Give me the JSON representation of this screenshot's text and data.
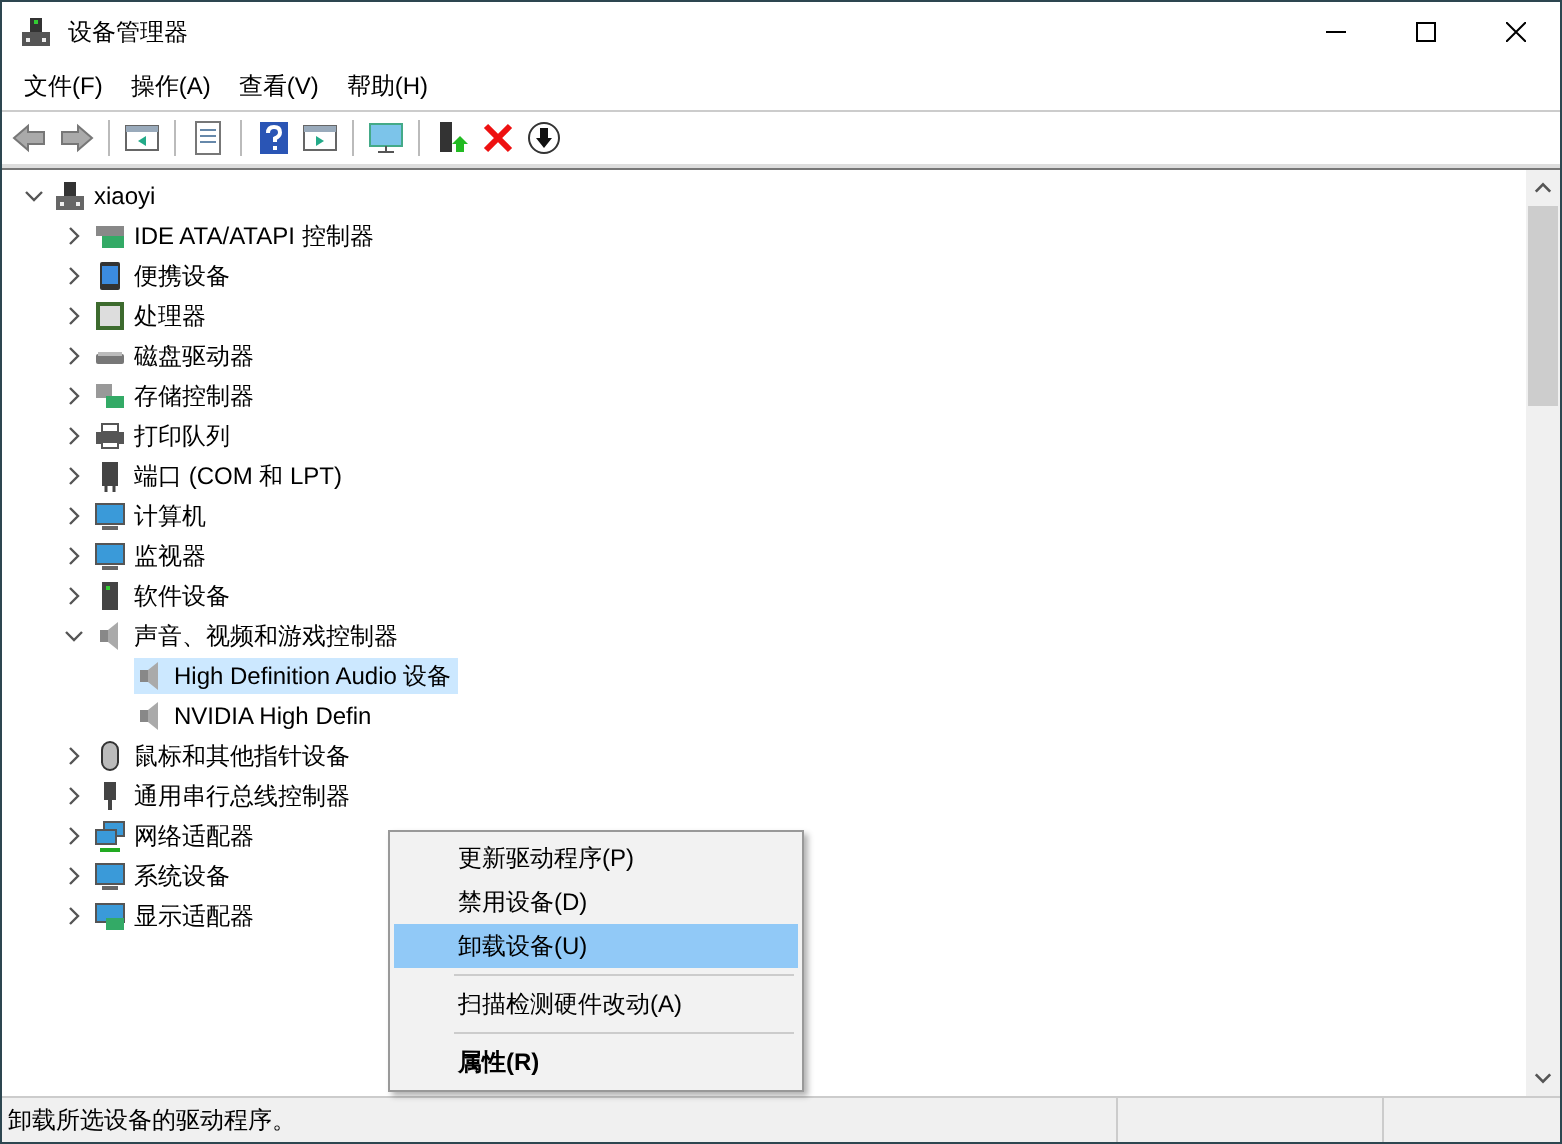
{
  "window": {
    "title": "设备管理器"
  },
  "menu_bar": [
    "文件(F)",
    "操作(A)",
    "查看(V)",
    "帮助(H)"
  ],
  "toolbar": [
    {
      "kind": "back",
      "disabled": true
    },
    {
      "kind": "forward",
      "disabled": true
    },
    {
      "kind": "sep"
    },
    {
      "kind": "panel-left"
    },
    {
      "kind": "sep"
    },
    {
      "kind": "properties"
    },
    {
      "kind": "sep"
    },
    {
      "kind": "help"
    },
    {
      "kind": "panel-right"
    },
    {
      "kind": "sep"
    },
    {
      "kind": "scan"
    },
    {
      "kind": "sep"
    },
    {
      "kind": "update"
    },
    {
      "kind": "remove"
    },
    {
      "kind": "download"
    }
  ],
  "tree": [
    {
      "label": "xiaoyi",
      "kind": "computer",
      "expanded": true,
      "selected": false,
      "children": [
        {
          "label": "IDE ATA/ATAPI 控制器",
          "kind": "ide",
          "expanded": false,
          "selected": false
        },
        {
          "label": "便携设备",
          "kind": "portable",
          "expanded": false,
          "selected": false
        },
        {
          "label": "处理器",
          "kind": "cpu",
          "expanded": false,
          "selected": false
        },
        {
          "label": "磁盘驱动器",
          "kind": "disk",
          "expanded": false,
          "selected": false
        },
        {
          "label": "存储控制器",
          "kind": "storage",
          "expanded": false,
          "selected": false
        },
        {
          "label": "打印队列",
          "kind": "printer",
          "expanded": false,
          "selected": false
        },
        {
          "label": "端口 (COM 和 LPT)",
          "kind": "port",
          "expanded": false,
          "selected": false
        },
        {
          "label": "计算机",
          "kind": "monitor",
          "expanded": false,
          "selected": false
        },
        {
          "label": "监视器",
          "kind": "monitor",
          "expanded": false,
          "selected": false
        },
        {
          "label": "软件设备",
          "kind": "software",
          "expanded": false,
          "selected": false
        },
        {
          "label": "声音、视频和游戏控制器",
          "kind": "sound",
          "expanded": true,
          "selected": false,
          "children": [
            {
              "label": "High Definition Audio 设备",
              "kind": "sound",
              "selected": true
            },
            {
              "label": "NVIDIA High Defin",
              "kind": "sound",
              "selected": false
            }
          ]
        },
        {
          "label": "鼠标和其他指针设备",
          "kind": "mouse",
          "expanded": false,
          "selected": false
        },
        {
          "label": "通用串行总线控制器",
          "kind": "usb",
          "expanded": false,
          "selected": false
        },
        {
          "label": "网络适配器",
          "kind": "network",
          "expanded": false,
          "selected": false
        },
        {
          "label": "系统设备",
          "kind": "system",
          "expanded": false,
          "selected": false
        },
        {
          "label": "显示适配器",
          "kind": "display",
          "expanded": false,
          "selected": false
        }
      ]
    }
  ],
  "context_menu": {
    "groups": [
      [
        {
          "label": "更新驱动程序(P)",
          "selected": false,
          "default": false
        },
        {
          "label": "禁用设备(D)",
          "selected": false,
          "default": false
        },
        {
          "label": "卸载设备(U)",
          "selected": true,
          "default": false
        }
      ],
      [
        {
          "label": "扫描检测硬件改动(A)",
          "selected": false,
          "default": false
        }
      ],
      [
        {
          "label": "属性(R)",
          "selected": false,
          "default": true
        }
      ]
    ]
  },
  "status_bar": {
    "text": "卸载所选设备的驱动程序。"
  }
}
